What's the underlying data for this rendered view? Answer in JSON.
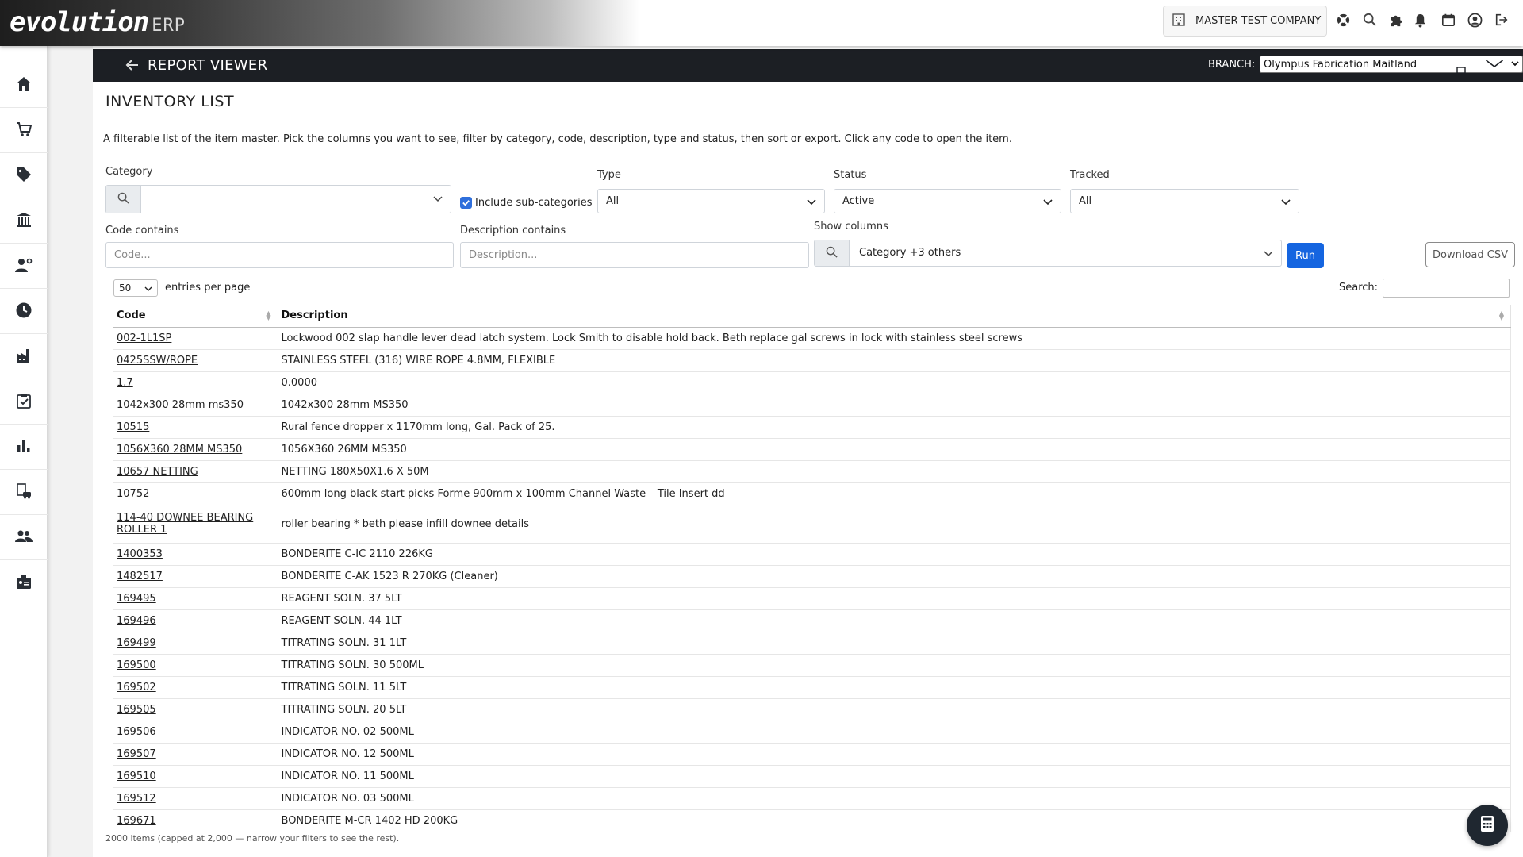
{
  "app": {
    "logo_text": "evolution",
    "logo_suffix": "ERP",
    "company": "MASTER TEST COMPANY",
    "top_icons": [
      "building-icon",
      "lifebuoy-icon",
      "search-icon",
      "puzzle-icon",
      "bell-icon",
      "calendar-icon",
      "user-circle-icon",
      "logout-icon"
    ]
  },
  "sidebar": {
    "items": [
      {
        "icon": "home-icon"
      },
      {
        "icon": "cart-icon"
      },
      {
        "icon": "tag-icon"
      },
      {
        "icon": "bank-icon"
      },
      {
        "icon": "user-settings-icon"
      },
      {
        "icon": "clock-icon"
      },
      {
        "icon": "factory-icon"
      },
      {
        "icon": "clipboard-check-icon"
      },
      {
        "icon": "bar-chart-icon"
      },
      {
        "icon": "building-car-icon"
      },
      {
        "icon": "people-icon"
      },
      {
        "icon": "id-badge-icon"
      }
    ]
  },
  "report_bar": {
    "title": "REPORT VIEWER",
    "branch_label": "BRANCH:",
    "branch_value": "Olympus Fabrication Maitland"
  },
  "page": {
    "title": "INVENTORY LIST",
    "intro": "A filterable list of the item master. Pick the columns you want to see, filter by category, code, description, type and status, then sort or export. Click any code to open the item."
  },
  "filters": {
    "category_label": "Category",
    "category_value": "",
    "include_sub_label": "Include sub-categories",
    "include_sub_checked": true,
    "type_label": "Type",
    "type_value": "All",
    "status_label": "Status",
    "status_value": "Active",
    "tracked_label": "Tracked",
    "tracked_value": "All",
    "code_label": "Code contains",
    "code_placeholder": "Code...",
    "desc_label": "Description contains",
    "desc_placeholder": "Description...",
    "columns_label": "Show columns",
    "columns_value": "Category +3 others",
    "run_label": "Run",
    "csv_label": "Download CSV"
  },
  "table_controls": {
    "page_size": "50",
    "page_size_label": "entries per page",
    "search_label": "Search:"
  },
  "table": {
    "headers": [
      "Code",
      "Description"
    ],
    "rows": [
      {
        "code": "002-1L1SP",
        "description": "Lockwood 002 slap handle lever dead latch system. Lock Smith to disable hold back. Beth replace gal screws in lock with stainless steel screws"
      },
      {
        "code": "0425SSW/ROPE",
        "description": "STAINLESS STEEL (316) WIRE ROPE 4.8MM, FLEXIBLE"
      },
      {
        "code": "1.7",
        "description": "0.0000"
      },
      {
        "code": "1042x300 28mm ms350",
        "description": "1042x300 28mm MS350"
      },
      {
        "code": "10515",
        "description": "Rural fence dropper x 1170mm long, Gal. Pack of 25."
      },
      {
        "code": "1056X360 28MM MS350",
        "description": "1056X360 26MM MS350"
      },
      {
        "code": "10657 NETTING",
        "description": "NETTING 180X50X1.6 X 50M"
      },
      {
        "code": "10752",
        "description": "600mm long black start picks Forme 900mm x 100mm Channel Waste – Tile Insert dd"
      },
      {
        "code": "114-40 DOWNEE BEARING ROLLER 1",
        "description": "roller bearing * beth please infill downee details"
      },
      {
        "code": "1400353",
        "description": "BONDERITE C-IC 2110 226KG"
      },
      {
        "code": "1482517",
        "description": "BONDERITE C-AK 1523 R 270KG (Cleaner)"
      },
      {
        "code": "169495",
        "description": "REAGENT SOLN. 37 5LT"
      },
      {
        "code": "169496",
        "description": "REAGENT SOLN. 44 1LT"
      },
      {
        "code": "169499",
        "description": "TITRATING SOLN. 31 1LT"
      },
      {
        "code": "169500",
        "description": "TITRATING SOLN. 30 500ML"
      },
      {
        "code": "169502",
        "description": "TITRATING SOLN. 11 5LT"
      },
      {
        "code": "169505",
        "description": "TITRATING SOLN. 20 5LT"
      },
      {
        "code": "169506",
        "description": "INDICATOR NO. 02 500ML"
      },
      {
        "code": "169507",
        "description": "INDICATOR NO. 12 500ML"
      },
      {
        "code": "169510",
        "description": "INDICATOR NO. 11 500ML"
      },
      {
        "code": "169512",
        "description": "INDICATOR NO. 03 500ML"
      },
      {
        "code": "169671",
        "description": "BONDERITE M-CR 1402 HD 200KG"
      }
    ]
  },
  "footer": {
    "note": "2000 items (capped at 2,000 — narrow your filters to see the rest)."
  },
  "colors": {
    "accent": "#1565e0",
    "report_bar": "#1c1f24"
  }
}
